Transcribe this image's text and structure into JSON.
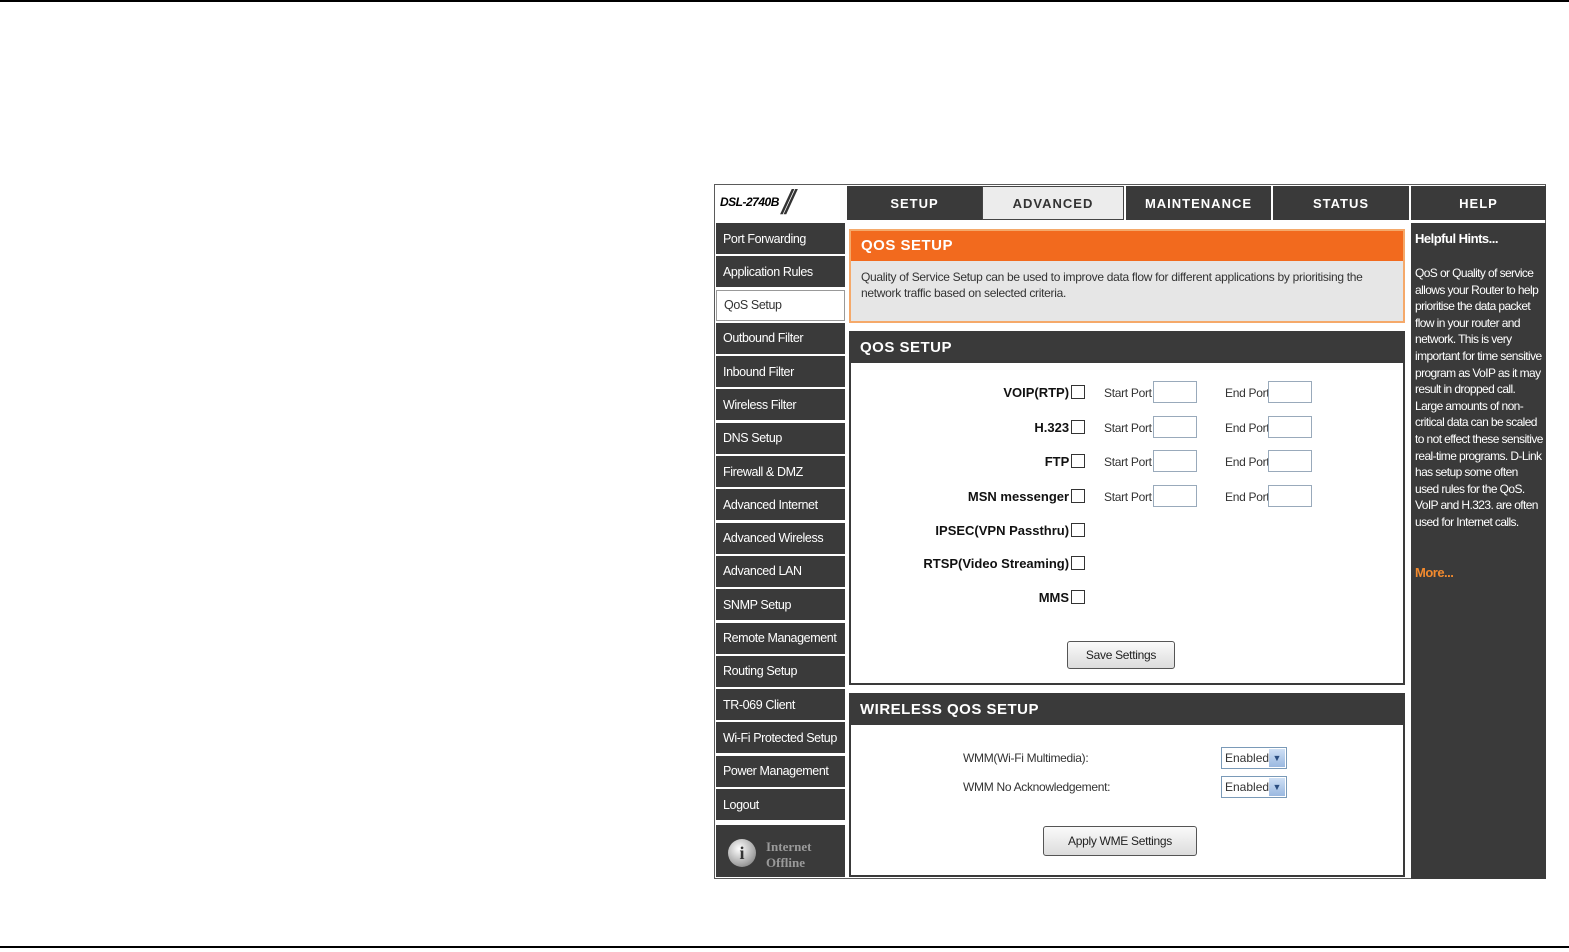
{
  "header": {
    "model": "DSL-2740B",
    "tabs": [
      "SETUP",
      "ADVANCED",
      "MAINTENANCE",
      "STATUS",
      "HELP"
    ],
    "active_tab": "ADVANCED"
  },
  "sidebar": {
    "items": [
      "Port Forwarding",
      "Application Rules",
      "QoS Setup",
      "Outbound Filter",
      "Inbound Filter",
      "Wireless Filter",
      "DNS Setup",
      "Firewall & DMZ",
      "Advanced Internet",
      "Advanced Wireless",
      "Advanced LAN",
      "SNMP Setup",
      "Remote Management",
      "Routing Setup",
      "TR-069 Client",
      "Wi-Fi Protected Setup",
      "Power Management",
      "Logout"
    ],
    "active_item": "QoS Setup",
    "status": {
      "line1": "Internet",
      "line2": "Offline"
    }
  },
  "intro": {
    "title": "QOS SETUP",
    "description": "Quality of Service Setup can be used to improve data flow for different applications by prioritising the network traffic based on selected criteria."
  },
  "qos": {
    "title": "QOS SETUP",
    "start_port_label": "Start Port",
    "end_port_label": "End Port",
    "rows": [
      {
        "label": "VOIP(RTP) :",
        "ports": true
      },
      {
        "label": "H.323 :",
        "ports": true
      },
      {
        "label": "FTP :",
        "ports": true
      },
      {
        "label": "MSN messenger :",
        "ports": true
      },
      {
        "label": "IPSEC(VPN Passthru) :",
        "ports": false
      },
      {
        "label": "RTSP(Video Streaming) :",
        "ports": false
      },
      {
        "label": "MMS :",
        "ports": false
      }
    ],
    "save_label": "Save Settings"
  },
  "wireless_qos": {
    "title": "WIRELESS QOS SETUP",
    "wmm_label": "WMM(Wi-Fi Multimedia):",
    "wmm_value": "Enabled",
    "noack_label": "WMM No Acknowledgement:",
    "noack_value": "Enabled",
    "apply_label": "Apply WME Settings"
  },
  "help": {
    "title": "Helpful Hints...",
    "text": "QoS or Quality of service allows your Router to help prioritise the data packet flow in your router and network. This is very important for time sensitive program as VoIP as it may result in dropped call. Large amounts of non-critical data can be scaled to not effect these sensitive real-time programs. D-Link has setup some often used rules for the QoS. VoIP and H.323. are often used for Internet calls.",
    "more": "More..."
  }
}
